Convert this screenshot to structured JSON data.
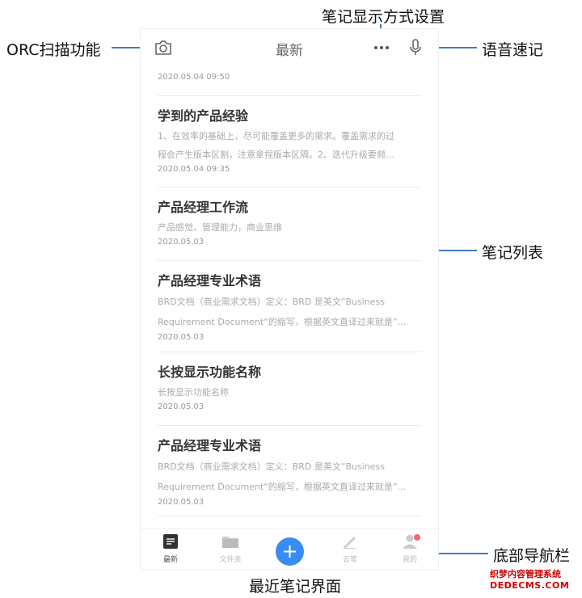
{
  "annotations": {
    "orc": "ORC扫描功能",
    "display_settings": "笔记显示方式设置",
    "voice": "语音速记",
    "list": "笔记列表",
    "bottom_nav": "底部导航栏",
    "caption": "最近笔记界面"
  },
  "header": {
    "title": "最新",
    "icons": [
      "camera-icon",
      "more-dots-icon",
      "microphone-icon"
    ]
  },
  "partial_note_date": "2020.05.04 09:50",
  "notes": [
    {
      "title": "学到的产品经验",
      "lines": [
        "1、在效率的基础上，尽可能覆盖更多的需求。覆盖需求的过",
        "程会产生版本区割，注意拿捏版本区隔。2、迭代升级要频…"
      ],
      "date": "2020.05.04 09:35"
    },
    {
      "title": "产品经理工作流",
      "lines": [
        "产品感觉、管理能力，商业思维"
      ],
      "date": "2020.05.03"
    },
    {
      "title": "产品经理专业术语",
      "lines": [
        "BRD文档（商业需求文档）定义：BRD 是英文”Business",
        "Requirement Document“的缩写，根据英文直译过来就是”…"
      ],
      "date": "2020.05.03"
    },
    {
      "title": "长按显示功能名称",
      "lines": [
        "长按显示功能名称"
      ],
      "date": "2020.05.03"
    },
    {
      "title": "产品经理专业术语",
      "lines": [
        "BRD文档（商业需求文档）定义：BRD 是英文”Business",
        "Requirement Document“的缩写，根据英文直译过来就是”…"
      ],
      "date": "2020.05.03"
    }
  ],
  "bottom_nav": {
    "items": [
      {
        "label": "最新",
        "icon": "note-icon",
        "active": true
      },
      {
        "label": "文件夹",
        "icon": "folder-icon",
        "active": false
      },
      {
        "label": "+",
        "icon": "add-icon",
        "active": false
      },
      {
        "label": "云笔",
        "icon": "pen-icon",
        "active": false
      },
      {
        "label": "我的",
        "icon": "user-icon",
        "active": false
      }
    ]
  },
  "watermark": {
    "top": "织梦内容管理系统",
    "bottom": "DEDECMS.COM"
  },
  "colors": {
    "accent": "#3a8cf5",
    "annotation_line": "#3d7cc9",
    "badge": "#f06a6a"
  }
}
